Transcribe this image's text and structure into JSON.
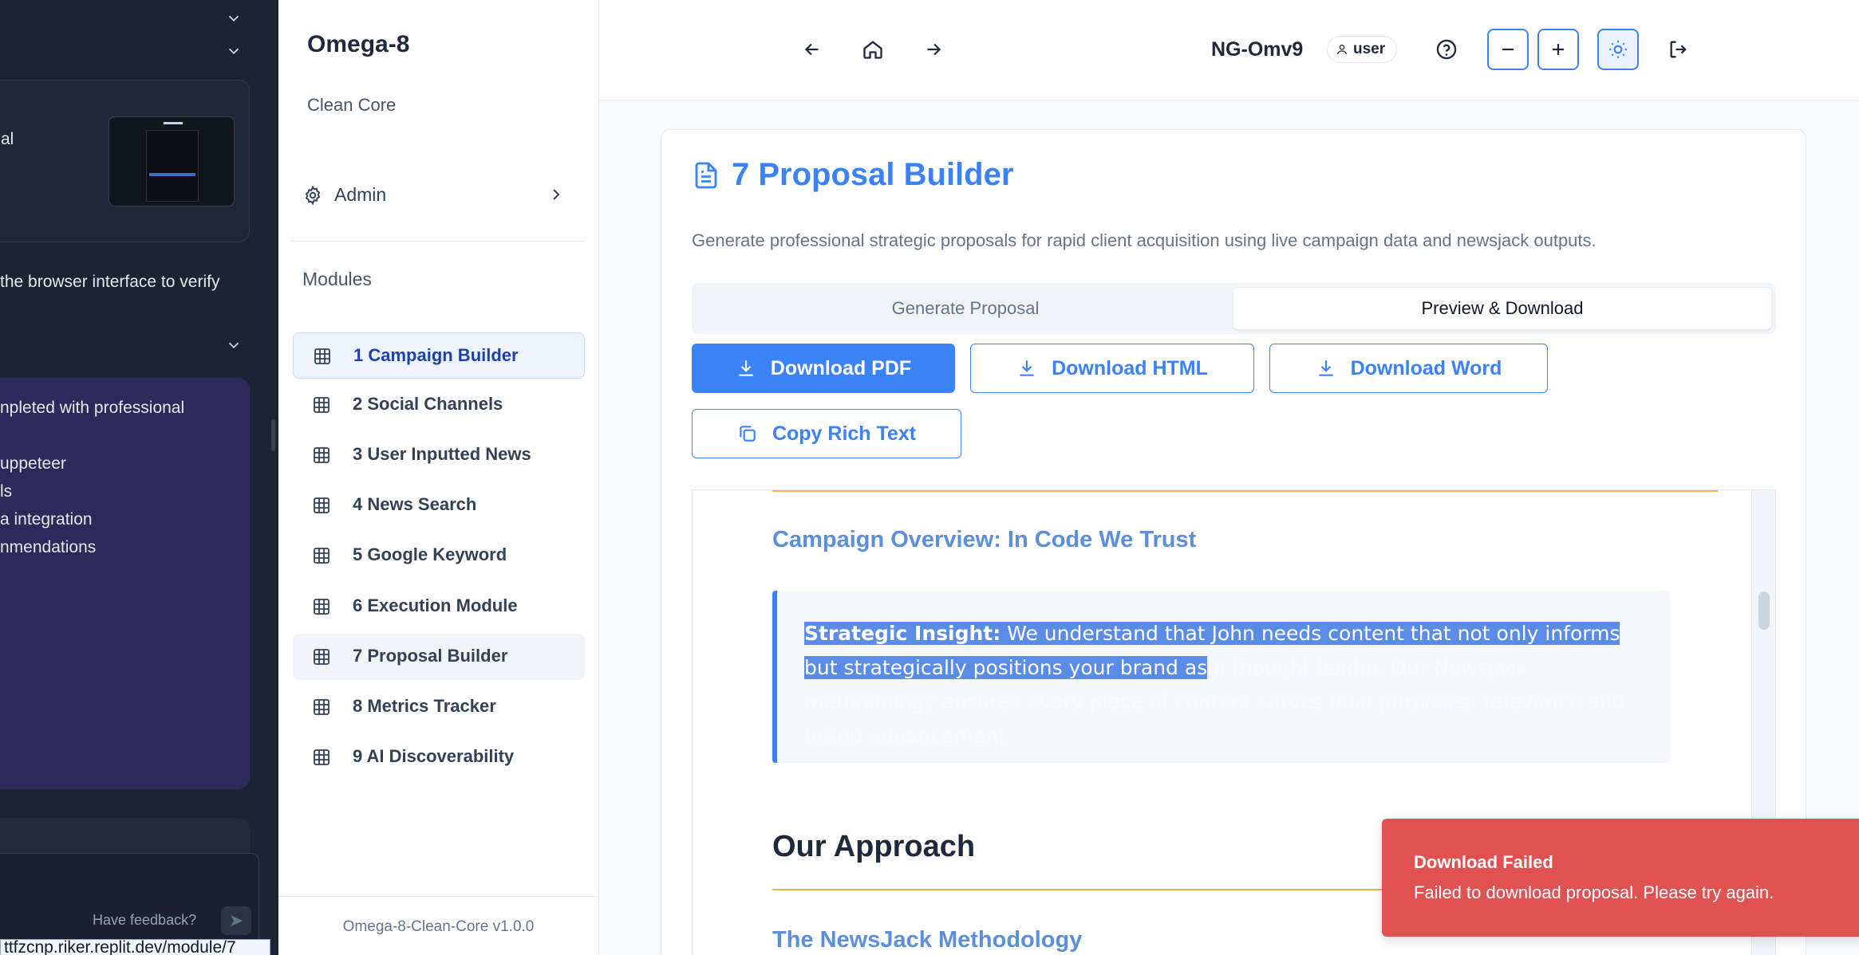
{
  "background_panel": {
    "card_text_1": "al",
    "body_text": "the browser interface to verify",
    "card_lines": [
      "npleted with professional",
      "uppeteer",
      "ls",
      "a integration",
      "nmendations"
    ],
    "feedback_label": "Have feedback?",
    "url": "ttfzcnp.riker.replit.dev/module/7"
  },
  "sidebar": {
    "app_title": "Omega-8",
    "app_subtitle": "Clean Core",
    "admin_label": "Admin",
    "modules_header": "Modules",
    "modules": [
      {
        "label": "1 Campaign Builder"
      },
      {
        "label": "2 Social Channels"
      },
      {
        "label": "3 User Inputted News"
      },
      {
        "label": "4 News Search"
      },
      {
        "label": "5 Google Keyword"
      },
      {
        "label": "6 Execution Module"
      },
      {
        "label": "7 Proposal Builder"
      },
      {
        "label": "8 Metrics Tracker"
      },
      {
        "label": "9 AI Discoverability"
      }
    ],
    "active_module": "1 Campaign Builder",
    "selected_module": "7 Proposal Builder",
    "version": "Omega-8-Clean-Core v1.0.0"
  },
  "header": {
    "project_name": "NG-Omv9",
    "user_badge": "user"
  },
  "main": {
    "page_title": "7 Proposal Builder",
    "description": "Generate professional strategic proposals for rapid client acquisition using live campaign data and newsjack outputs.",
    "tabs": [
      {
        "label": "Generate Proposal",
        "active": false
      },
      {
        "label": "Preview & Download",
        "active": true
      }
    ],
    "buttons": {
      "download_pdf": "Download PDF",
      "download_html": "Download HTML",
      "download_word": "Download Word",
      "copy_rich_text": "Copy Rich Text"
    },
    "preview": {
      "overview_heading": "Campaign Overview: In Code We Trust",
      "insight_label": "Strategic Insight:",
      "insight_selected": " We understand that John needs content that not only informs but strategically positions your brand as",
      "insight_rest": " a thought leader. Our Newsjack methodology ensures every piece of content serves dual purposes: relevance and brand advancement.",
      "approach_heading": "Our Approach",
      "newsjack_heading": "The NewsJack Methodology"
    }
  },
  "toast": {
    "title": "Download Failed",
    "message": "Failed to download proposal. Please try again."
  },
  "colors": {
    "accent": "#3b82f6",
    "gold_rule": "#f0b54a",
    "toast_error": "#e05252",
    "dark_panel": "#1c2333",
    "purple_card": "#2d2a5b"
  }
}
